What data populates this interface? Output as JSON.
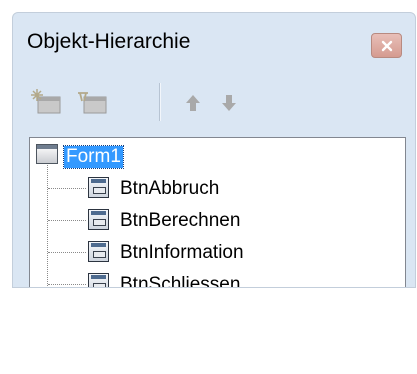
{
  "window": {
    "title": "Objekt-Hierarchie",
    "close_icon": "close-icon"
  },
  "toolbar": {
    "buttons": [
      {
        "icon": "add-object-icon",
        "enabled": false
      },
      {
        "icon": "remove-object-icon",
        "enabled": false
      },
      {
        "icon": "arrow-up-icon",
        "enabled": false
      },
      {
        "icon": "arrow-down-icon",
        "enabled": false
      }
    ]
  },
  "tree": {
    "root": {
      "label": "Form1",
      "selected": true,
      "icon": "form-icon"
    },
    "children": [
      {
        "label": "BtnAbbruch",
        "icon": "button-control-icon"
      },
      {
        "label": "BtnBerechnen",
        "icon": "button-control-icon"
      },
      {
        "label": "BtnInformation",
        "icon": "button-control-icon"
      },
      {
        "label": "BtnSchliessen",
        "icon": "button-control-icon"
      }
    ]
  },
  "colors": {
    "window_bg": "#dae6f3",
    "selection_bg": "#3399ff",
    "close_button": "#d59b90"
  }
}
